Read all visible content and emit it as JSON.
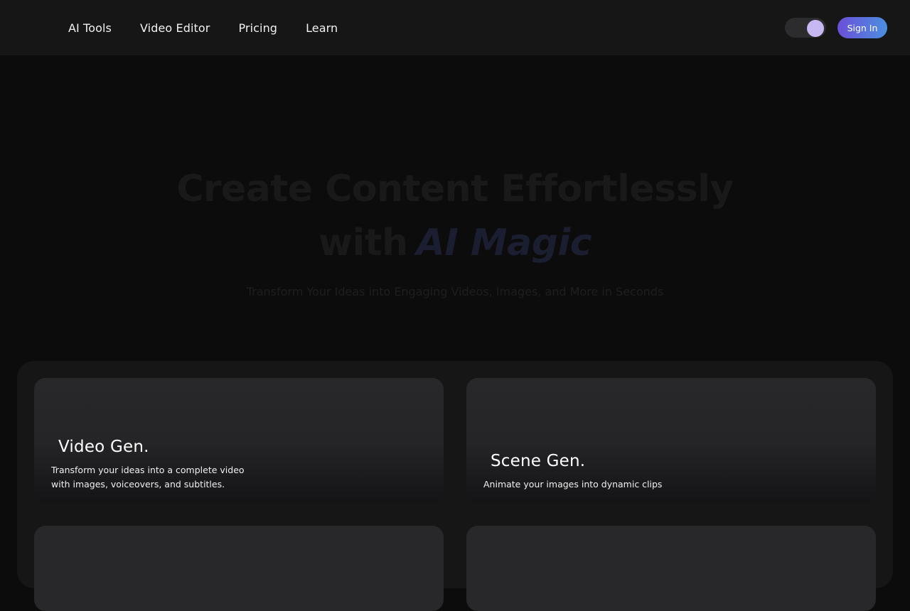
{
  "nav": {
    "links": [
      "AI Tools",
      "Video Editor",
      "Pricing",
      "Learn"
    ],
    "sign_in": "Sign In"
  },
  "hero": {
    "line1": "Create Content Effortlessly",
    "line2_prefix": "with",
    "line2_accent": "AI Magic",
    "subtitle": "Transform Your Ideas into Engaging Videos, Images, and More in Seconds"
  },
  "cards": [
    {
      "title": "Video Gen.",
      "desc_line1": "Transform your ideas into a complete video",
      "desc_line2": "with images, voiceovers, and subtitles."
    },
    {
      "title": "Scene Gen.",
      "desc_line1": "Animate your images into dynamic clips"
    }
  ],
  "colors": {
    "page_bg": "#0c0c0c",
    "nav_bg": "#161616",
    "accent_start": "#6a4fd8",
    "accent_end": "#4c8fe0",
    "toggle_knob": "#c9b7f3"
  }
}
